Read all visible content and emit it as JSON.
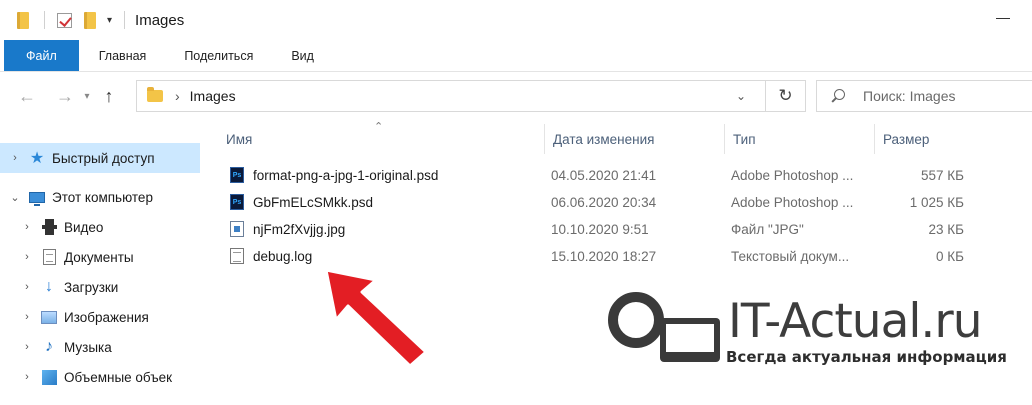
{
  "window": {
    "title": "Images"
  },
  "ribbon": {
    "tabs": [
      {
        "label": "Файл"
      },
      {
        "label": "Главная"
      },
      {
        "label": "Поделиться"
      },
      {
        "label": "Вид"
      }
    ]
  },
  "address_bar": {
    "path": "Images",
    "search_placeholder": "Поиск: Images"
  },
  "sidebar": {
    "items": [
      {
        "label": "Быстрый доступ",
        "icon": "star-icon",
        "selected": true
      },
      {
        "label": "Этот компьютер",
        "icon": "computer-icon"
      },
      {
        "label": "Видео",
        "icon": "video-icon"
      },
      {
        "label": "Документы",
        "icon": "documents-icon"
      },
      {
        "label": "Загрузки",
        "icon": "downloads-icon"
      },
      {
        "label": "Изображения",
        "icon": "pictures-icon"
      },
      {
        "label": "Музыка",
        "icon": "music-icon"
      },
      {
        "label": "Объемные объек",
        "icon": "3d-objects-icon"
      }
    ]
  },
  "file_list": {
    "columns": [
      "Имя",
      "Дата изменения",
      "Тип",
      "Размер"
    ],
    "rows": [
      {
        "name": "format-png-a-jpg-1-original.psd",
        "date": "04.05.2020 21:41",
        "type": "Adobe Photoshop ...",
        "size": "557 КБ",
        "icon": "psd-file-icon"
      },
      {
        "name": "GbFmELcSMkk.psd",
        "date": "06.06.2020 20:34",
        "type": "Adobe Photoshop ...",
        "size": "1 025 КБ",
        "icon": "psd-file-icon"
      },
      {
        "name": "njFm2fXvjjg.jpg",
        "date": "10.10.2020 9:51",
        "type": "Файл \"JPG\"",
        "size": "23 КБ",
        "icon": "jpg-file-icon"
      },
      {
        "name": "debug.log",
        "date": "15.10.2020 18:27",
        "type": "Текстовый докум...",
        "size": "0 КБ",
        "icon": "text-file-icon"
      }
    ]
  },
  "watermark": {
    "title": "IT-Actual.ru",
    "subtitle": "Всегда актуальная информация"
  },
  "colors": {
    "accent": "#1979ca",
    "selection": "#cce8ff",
    "arrow": "#e31e24"
  }
}
